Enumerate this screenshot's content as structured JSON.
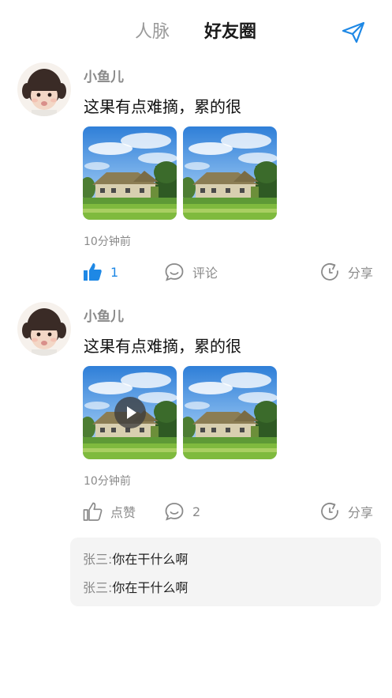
{
  "header": {
    "tabs": [
      {
        "label": "人脉",
        "active": false
      },
      {
        "label": "好友圈",
        "active": true
      }
    ],
    "send_icon": "paper-plane-icon",
    "accent_color": "#1e88e5"
  },
  "posts": [
    {
      "user": "小鱼儿",
      "text": "这果有点难摘，累的很",
      "images": [
        "cottage-landscape",
        "cottage-landscape"
      ],
      "time": "10分钟前",
      "like_label": "1",
      "liked": true,
      "comment_label": "评论",
      "share_label": "分享"
    },
    {
      "user": "小鱼儿",
      "text": "这果有点难摘，累的很",
      "images": [
        "cottage-landscape",
        "cottage-landscape"
      ],
      "video_first": true,
      "time": "10分钟前",
      "like_label": "点赞",
      "liked": false,
      "comment_label": "2",
      "share_label": "分享",
      "comments": [
        {
          "user": "张三:",
          "text": "你在干什么啊"
        },
        {
          "user": "张三:",
          "text": "你在干什么啊"
        }
      ]
    }
  ]
}
